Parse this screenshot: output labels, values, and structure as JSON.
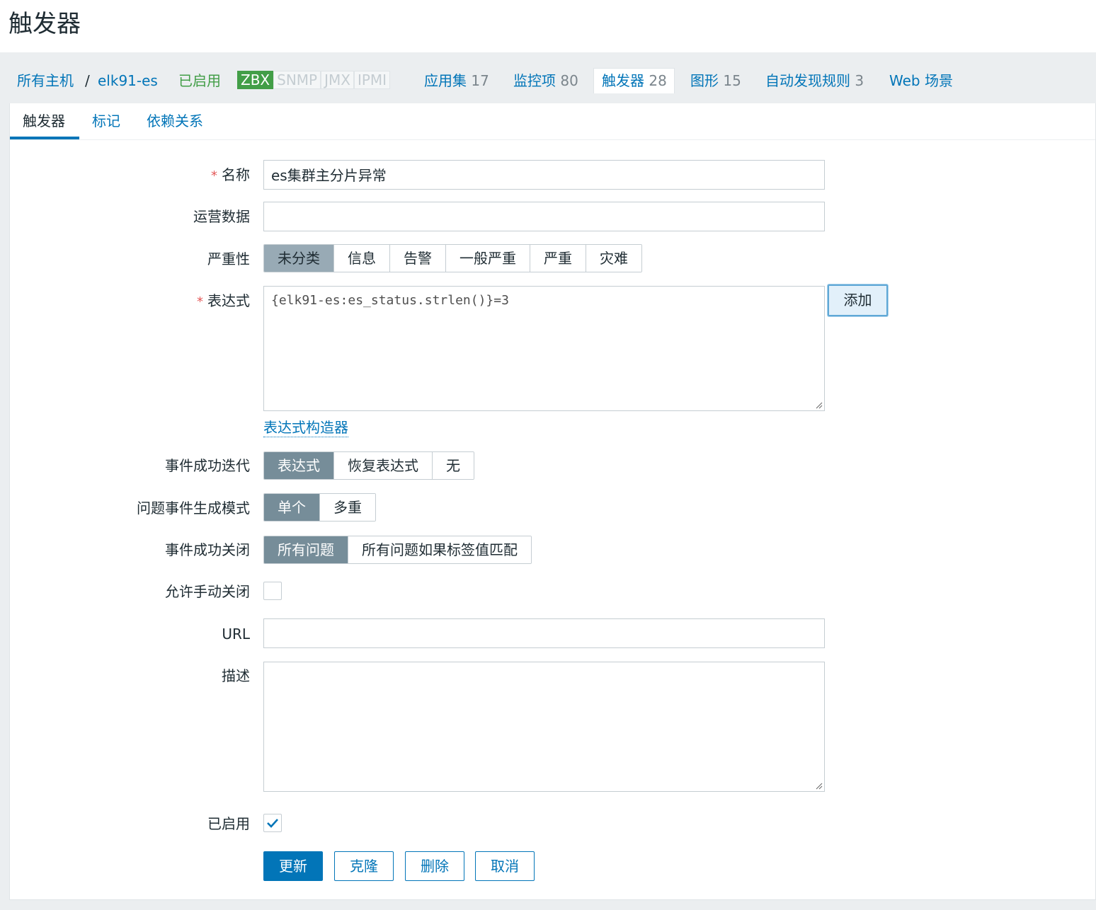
{
  "page": {
    "title": "触发器"
  },
  "nav": {
    "all_hosts": "所有主机",
    "separator": "/",
    "host": "elk91-es",
    "status": "已启用",
    "availability": [
      "ZBX",
      "SNMP",
      "JMX",
      "IPMI"
    ],
    "items": [
      {
        "label": "应用集",
        "count": "17"
      },
      {
        "label": "监控项",
        "count": "80"
      },
      {
        "label": "触发器",
        "count": "28"
      },
      {
        "label": "图形",
        "count": "15"
      },
      {
        "label": "自动发现规则",
        "count": "3"
      },
      {
        "label": "Web 场景",
        "count": ""
      }
    ]
  },
  "tabs": [
    "触发器",
    "标记",
    "依赖关系"
  ],
  "form": {
    "name": {
      "label": "名称",
      "value": "es集群主分片异常"
    },
    "opdata": {
      "label": "运营数据",
      "value": ""
    },
    "severity": {
      "label": "严重性",
      "options": [
        "未分类",
        "信息",
        "告警",
        "一般严重",
        "严重",
        "灾难"
      ],
      "selected": "未分类"
    },
    "expression": {
      "label": "表达式",
      "value": "{elk91-es:es_status.strlen()}=3",
      "add_button": "添加",
      "constructor_link": "表达式构造器"
    },
    "recovery_mode": {
      "label": "事件成功迭代",
      "options": [
        "表达式",
        "恢复表达式",
        "无"
      ],
      "selected": "表达式"
    },
    "problem_mode": {
      "label": "问题事件生成模式",
      "options": [
        "单个",
        "多重"
      ],
      "selected": "单个"
    },
    "ok_close": {
      "label": "事件成功关闭",
      "options": [
        "所有问题",
        "所有问题如果标签值匹配"
      ],
      "selected": "所有问题"
    },
    "manual_close": {
      "label": "允许手动关闭",
      "checked": false
    },
    "url": {
      "label": "URL",
      "value": ""
    },
    "description": {
      "label": "描述",
      "value": ""
    },
    "enabled": {
      "label": "已启用",
      "checked": true
    }
  },
  "buttons": {
    "update": "更新",
    "clone": "克隆",
    "delete": "删除",
    "cancel": "取消"
  },
  "colors": {
    "link": "#0275b8",
    "selected_segment": "#768d99",
    "enabled_green": "#429e47",
    "required_star": "#e45959"
  }
}
